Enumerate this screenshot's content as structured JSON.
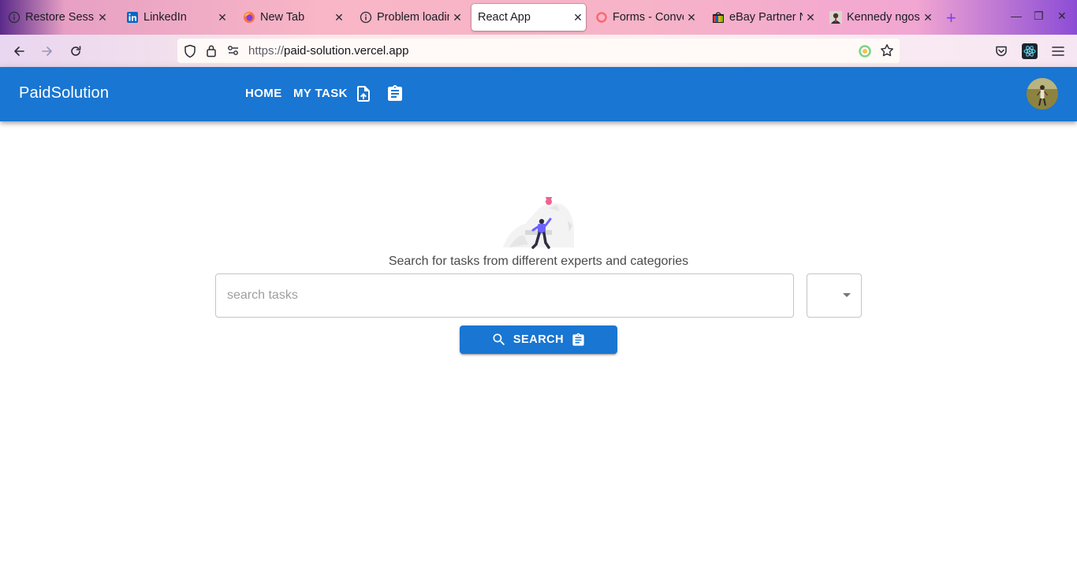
{
  "browser": {
    "tabs": [
      {
        "title": "Restore Session",
        "icon": "info-icon",
        "active": false
      },
      {
        "title": "LinkedIn",
        "icon": "linkedin-icon",
        "active": false
      },
      {
        "title": "New Tab",
        "icon": "firefox-icon",
        "active": false
      },
      {
        "title": "Problem loading page",
        "icon": "info-icon",
        "active": false
      },
      {
        "title": "React App",
        "icon": "",
        "active": true
      },
      {
        "title": "Forms - Convertkit",
        "icon": "convertkit-icon",
        "active": false
      },
      {
        "title": "eBay Partner Network",
        "icon": "ebay-icon",
        "active": false
      },
      {
        "title": "Kennedy ngosa",
        "icon": "profile-photo-icon",
        "active": false
      }
    ],
    "url_protocol": "https://",
    "url_host": "paid-solution.vercel.app"
  },
  "appbar": {
    "brand": "PaidSolution",
    "nav": {
      "home": "HOME",
      "my_task": "MY TASK"
    },
    "accent_color": "#1976d2"
  },
  "main": {
    "subtitle": "Search for tasks from different experts and categories",
    "search_placeholder": "search tasks",
    "search_value": "",
    "category_value": "",
    "search_button": "SEARCH"
  }
}
